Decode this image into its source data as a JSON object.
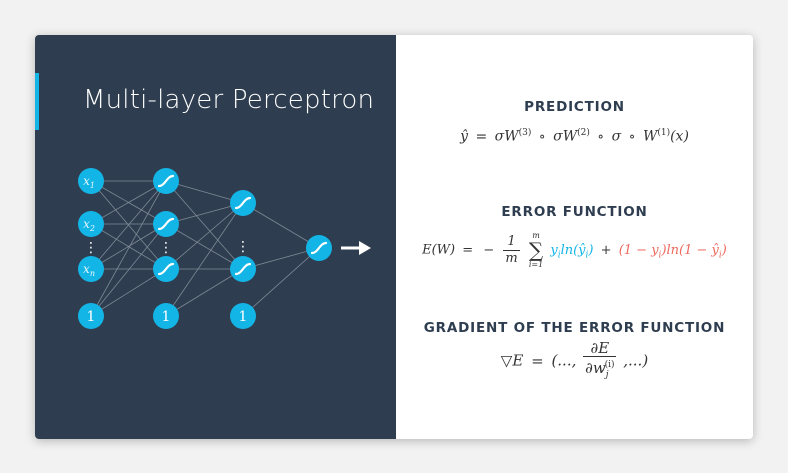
{
  "left": {
    "title": "Multi-layer Perceptron",
    "accent_color": "#13b5e6",
    "node_color": "#13b5e6",
    "panel_color": "#2e3d4f",
    "input_labels": [
      "x",
      "x",
      "x",
      "1"
    ],
    "input_subscripts": [
      "1",
      "2",
      "n",
      ""
    ],
    "bias_label": "1",
    "dots_label": "⋮",
    "activation_icon": "sigmoid-icon",
    "output_arrow_icon": "right-arrow-icon"
  },
  "right": {
    "prediction": {
      "heading": "PREDICTION",
      "yhat": "ŷ",
      "eq": "=",
      "sigma": "σ",
      "W": "W",
      "sup3": "(3)",
      "sup2": "(2)",
      "sup1": "(1)",
      "circ": "∘",
      "x_arg": "(x)"
    },
    "error": {
      "heading": "ERROR FUNCTION",
      "lhs": "E(W)",
      "eq": "=",
      "minus": "−",
      "frac_num": "1",
      "frac_den": "m",
      "sum_upper": "m",
      "sum_symbol": "∑",
      "sum_lower": "i=1",
      "term1": "y",
      "term1_sub": "i",
      "term1_rest": "ln(ŷ",
      "term1_sub2": "i",
      "term1_close": ")",
      "plus": "+",
      "term2": "(1 − y",
      "term2_sub": "i",
      "term2_rest": ")ln(1 − ŷ",
      "term2_sub2": "i",
      "term2_close": ")"
    },
    "gradient": {
      "heading": "GRADIENT OF THE ERROR FUNCTION",
      "nabla": "▽E",
      "eq": "=",
      "open": "(...,",
      "num": "∂E",
      "den": "∂w",
      "den_sub": "j",
      "den_sup": "(i)",
      "close": ",...)"
    }
  }
}
